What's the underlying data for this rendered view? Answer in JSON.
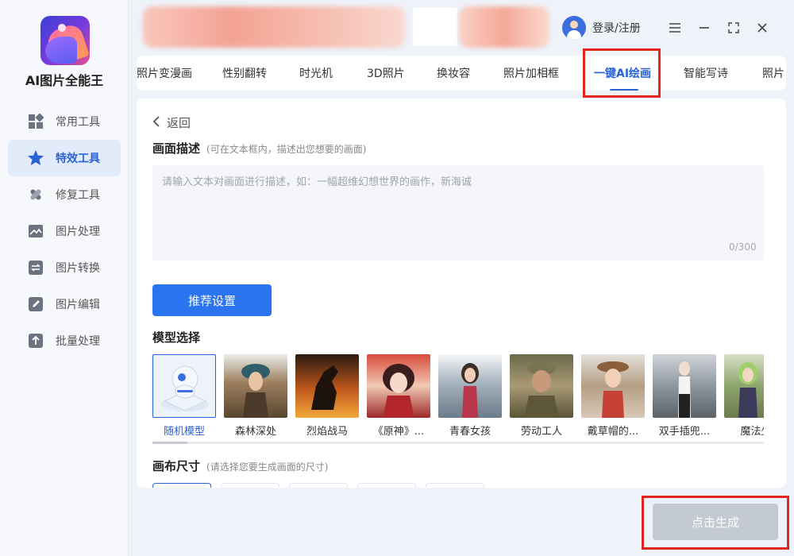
{
  "app": {
    "name": "AI图片全能王"
  },
  "sidebar": {
    "items": [
      {
        "label": "常用工具",
        "icon": "grid-icon",
        "active": false
      },
      {
        "label": "特效工具",
        "icon": "star-icon",
        "active": true
      },
      {
        "label": "修复工具",
        "icon": "bandage-icon",
        "active": false
      },
      {
        "label": "图片处理",
        "icon": "image-icon",
        "active": false
      },
      {
        "label": "图片转换",
        "icon": "convert-icon",
        "active": false
      },
      {
        "label": "图片编辑",
        "icon": "edit-icon",
        "active": false
      },
      {
        "label": "批量处理",
        "icon": "upload-icon",
        "active": false
      }
    ]
  },
  "header": {
    "login_label": "登录/注册"
  },
  "tabs": [
    {
      "label": "照片变漫画"
    },
    {
      "label": "性别翻转"
    },
    {
      "label": "时光机"
    },
    {
      "label": "3D照片"
    },
    {
      "label": "换妆容"
    },
    {
      "label": "照片加相框"
    },
    {
      "label": "一键AI绘画"
    },
    {
      "label": "智能写诗"
    },
    {
      "label": "照片"
    }
  ],
  "main": {
    "back_label": "返回",
    "description": {
      "title": "画面描述",
      "hint": "(可在文本框内，描述出您想要的画面)",
      "placeholder": "请输入文本对画面进行描述，如：一幅超维幻想世界的画作，新海诚",
      "counter": "0/300"
    },
    "recommend_button": "推荐设置",
    "model_section": {
      "title": "模型选择",
      "models": [
        {
          "label": "随机模型",
          "selected": true
        },
        {
          "label": "森林深处"
        },
        {
          "label": "烈焰战马"
        },
        {
          "label": "《原神》..."
        },
        {
          "label": "青春女孩"
        },
        {
          "label": "劳动工人"
        },
        {
          "label": "戴草帽的..."
        },
        {
          "label": "双手插兜..."
        },
        {
          "label": "魔法少"
        }
      ]
    },
    "canvas_section": {
      "title": "画布尺寸",
      "hint": "(请选择您要生成画面的尺寸)"
    }
  },
  "footer": {
    "generate_button": "点击生成"
  },
  "colors": {
    "accent": "#2a62d8",
    "primary_button": "#2a74f0",
    "disabled_button": "#c4cad3",
    "highlight_box": "#e0261f"
  }
}
